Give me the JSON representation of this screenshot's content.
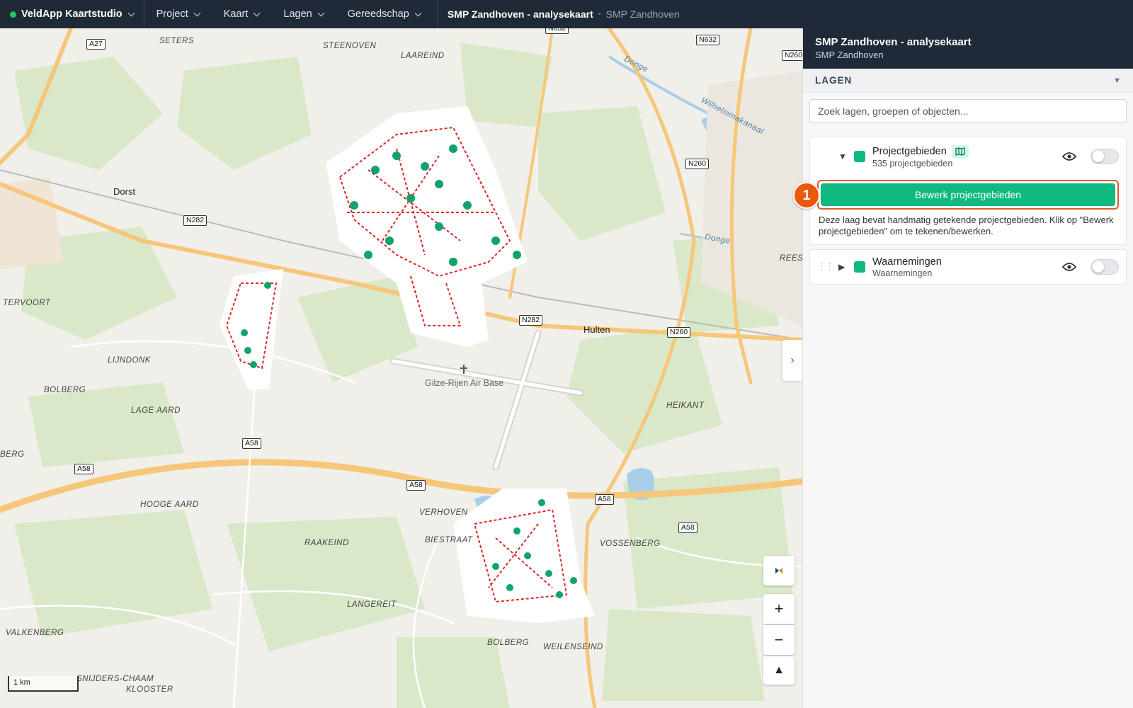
{
  "topbar": {
    "brand": "VeldApp Kaartstudio",
    "menus": [
      "Project",
      "Kaart",
      "Lagen",
      "Gereedschap"
    ],
    "project_title": "SMP Zandhoven - analysekaart",
    "project_sub": "SMP Zandhoven"
  },
  "map": {
    "places": [
      "Dorst",
      "Hulten"
    ],
    "areas": [
      "SETERS",
      "STEENOVEN",
      "LAAREIND",
      "TERVOORT",
      "LIJNDONK",
      "BOLBERG",
      "LAGE AARD",
      "BERG",
      "HOOGE AARD",
      "VERHOVEN",
      "RAAKEIND",
      "BIESTRAAT",
      "LANGEREIT",
      "BOLBERG",
      "WEILENSEIND",
      "VOSSENBERG",
      "HEIKANT",
      "VALKENBERG",
      "SNIJDERS-CHAAM",
      "KLOOSTER",
      "REESI",
      "Donge",
      "Donge",
      "Wilhelminakanaal"
    ],
    "airbase": "Gilze-Rijen Air Base",
    "roads": [
      "A27",
      "N632",
      "N632",
      "N260",
      "N282",
      "N260",
      "N282",
      "N260",
      "A58",
      "A58",
      "A58",
      "A58",
      "A58"
    ],
    "scale": "1 km"
  },
  "controls": {
    "compass_icon": "compass-icon",
    "zoom_in": "+",
    "zoom_out": "−",
    "north": "▲"
  },
  "panel": {
    "title": "SMP Zandhoven - analysekaart",
    "subtitle": "SMP Zandhoven",
    "section": "LAGEN",
    "search_placeholder": "Zoek lagen, groepen of objecten...",
    "layers": [
      {
        "name": "Projectgebieden",
        "sub": "535 projectgebieden",
        "color": "#10b981",
        "expanded": true,
        "visible": false,
        "edit_button": "Bewerk projectgebieden",
        "help": "Deze laag bevat handmatig getekende projectgebieden. Klik op \"Bewerk projectgebieden\" om te tekenen/bewerken."
      },
      {
        "name": "Waarnemingen",
        "sub": "Waarnemingen",
        "color": "#10b981",
        "expanded": false,
        "visible": false
      }
    ],
    "step_badge": "1"
  }
}
